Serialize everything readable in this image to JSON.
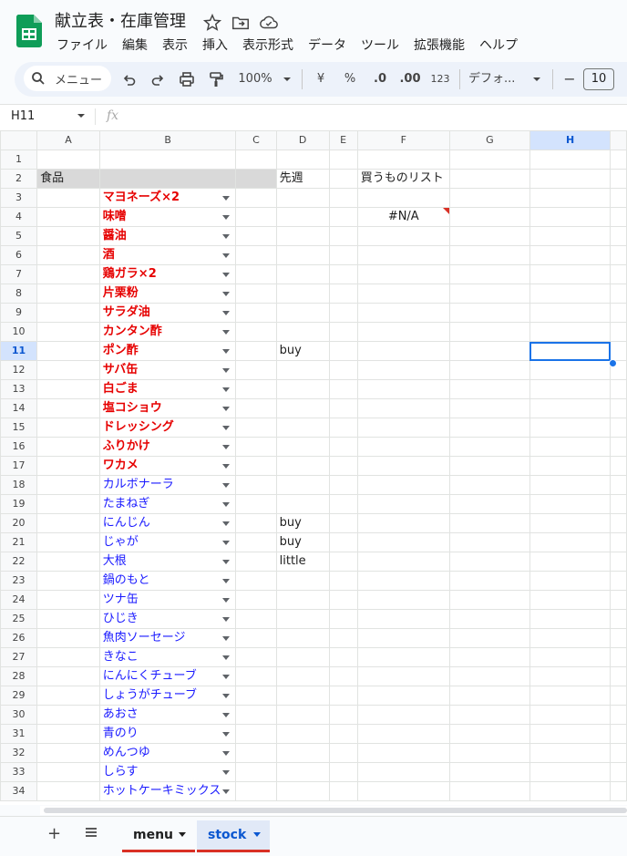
{
  "doc": {
    "title": "献立表・在庫管理",
    "menu": [
      "ファイル",
      "編集",
      "表示",
      "挿入",
      "表示形式",
      "データ",
      "ツール",
      "拡張機能",
      "ヘルプ"
    ]
  },
  "toolbar": {
    "search_label": "メニュー",
    "zoom": "100%",
    "currency": "¥",
    "percent": "%",
    "dec_decrease": ".0",
    "dec_increase": ".00",
    "number_format": "123",
    "font": "デフォ...",
    "font_size": "10",
    "minus": "−"
  },
  "formula_bar": {
    "name_box": "H11",
    "fx": "fx"
  },
  "grid": {
    "columns": [
      "A",
      "B",
      "C",
      "D",
      "E",
      "F",
      "G",
      "H"
    ],
    "rows": [
      {
        "n": "1",
        "a": "",
        "b": "",
        "bstyle": "",
        "d": "",
        "f": ""
      },
      {
        "n": "2",
        "a": "食品",
        "b": "",
        "bstyle": "hdr",
        "d": "先週",
        "f": "買うものリスト"
      },
      {
        "n": "3",
        "a": "",
        "b": "マヨネーズ×2",
        "bstyle": "red",
        "d": "",
        "f": ""
      },
      {
        "n": "4",
        "a": "",
        "b": "味噌",
        "bstyle": "red",
        "d": "",
        "f": "#N/A"
      },
      {
        "n": "5",
        "a": "",
        "b": "醤油",
        "bstyle": "red",
        "d": "",
        "f": ""
      },
      {
        "n": "6",
        "a": "",
        "b": "酒",
        "bstyle": "red",
        "d": "",
        "f": ""
      },
      {
        "n": "7",
        "a": "",
        "b": "鶏ガラ×2",
        "bstyle": "red",
        "d": "",
        "f": ""
      },
      {
        "n": "8",
        "a": "",
        "b": "片栗粉",
        "bstyle": "red",
        "d": "",
        "f": ""
      },
      {
        "n": "9",
        "a": "",
        "b": "サラダ油",
        "bstyle": "red",
        "d": "",
        "f": ""
      },
      {
        "n": "10",
        "a": "",
        "b": "カンタン酢",
        "bstyle": "red",
        "d": "",
        "f": ""
      },
      {
        "n": "11",
        "a": "",
        "b": "ポン酢",
        "bstyle": "red",
        "d": "buy",
        "f": ""
      },
      {
        "n": "12",
        "a": "",
        "b": "サバ缶",
        "bstyle": "red",
        "d": "",
        "f": ""
      },
      {
        "n": "13",
        "a": "",
        "b": "白ごま",
        "bstyle": "red",
        "d": "",
        "f": ""
      },
      {
        "n": "14",
        "a": "",
        "b": "塩コショウ",
        "bstyle": "red",
        "d": "",
        "f": ""
      },
      {
        "n": "15",
        "a": "",
        "b": "ドレッシング",
        "bstyle": "red",
        "d": "",
        "f": ""
      },
      {
        "n": "16",
        "a": "",
        "b": "ふりかけ",
        "bstyle": "red",
        "d": "",
        "f": ""
      },
      {
        "n": "17",
        "a": "",
        "b": "ワカメ",
        "bstyle": "red",
        "d": "",
        "f": ""
      },
      {
        "n": "18",
        "a": "",
        "b": "カルボナーラ",
        "bstyle": "blue",
        "d": "",
        "f": ""
      },
      {
        "n": "19",
        "a": "",
        "b": "たまねぎ",
        "bstyle": "blue",
        "d": "",
        "f": ""
      },
      {
        "n": "20",
        "a": "",
        "b": "にんじん",
        "bstyle": "blue",
        "d": "buy",
        "f": ""
      },
      {
        "n": "21",
        "a": "",
        "b": "じゃが",
        "bstyle": "blue",
        "d": "buy",
        "f": ""
      },
      {
        "n": "22",
        "a": "",
        "b": "大根",
        "bstyle": "blue",
        "d": "little",
        "f": ""
      },
      {
        "n": "23",
        "a": "",
        "b": "鍋のもと",
        "bstyle": "blue",
        "d": "",
        "f": ""
      },
      {
        "n": "24",
        "a": "",
        "b": "ツナ缶",
        "bstyle": "blue",
        "d": "",
        "f": ""
      },
      {
        "n": "25",
        "a": "",
        "b": "ひじき",
        "bstyle": "blue",
        "d": "",
        "f": ""
      },
      {
        "n": "26",
        "a": "",
        "b": "魚肉ソーセージ",
        "bstyle": "blue",
        "d": "",
        "f": ""
      },
      {
        "n": "27",
        "a": "",
        "b": "きなこ",
        "bstyle": "blue",
        "d": "",
        "f": ""
      },
      {
        "n": "28",
        "a": "",
        "b": "にんにくチューブ",
        "bstyle": "blue",
        "d": "",
        "f": ""
      },
      {
        "n": "29",
        "a": "",
        "b": "しょうがチューブ",
        "bstyle": "blue",
        "d": "",
        "f": ""
      },
      {
        "n": "30",
        "a": "",
        "b": "あおさ",
        "bstyle": "blue",
        "d": "",
        "f": ""
      },
      {
        "n": "31",
        "a": "",
        "b": "青のり",
        "bstyle": "blue",
        "d": "",
        "f": ""
      },
      {
        "n": "32",
        "a": "",
        "b": "めんつゆ",
        "bstyle": "blue",
        "d": "",
        "f": ""
      },
      {
        "n": "33",
        "a": "",
        "b": "しらす",
        "bstyle": "blue",
        "d": "",
        "f": ""
      },
      {
        "n": "34",
        "a": "",
        "b": "ホットケーキミックス",
        "bstyle": "blue",
        "d": "",
        "f": ""
      }
    ],
    "selected_cell": "H11"
  },
  "sheets": {
    "tabs": [
      {
        "label": "menu"
      },
      {
        "label": "stock"
      }
    ],
    "active": "stock"
  },
  "colors": {
    "red_text": "#e60000",
    "blue_text": "#1a1aff",
    "header_fill": "#d9d9d9",
    "selection": "#1a73e8",
    "tab_underline": "#d93025"
  }
}
